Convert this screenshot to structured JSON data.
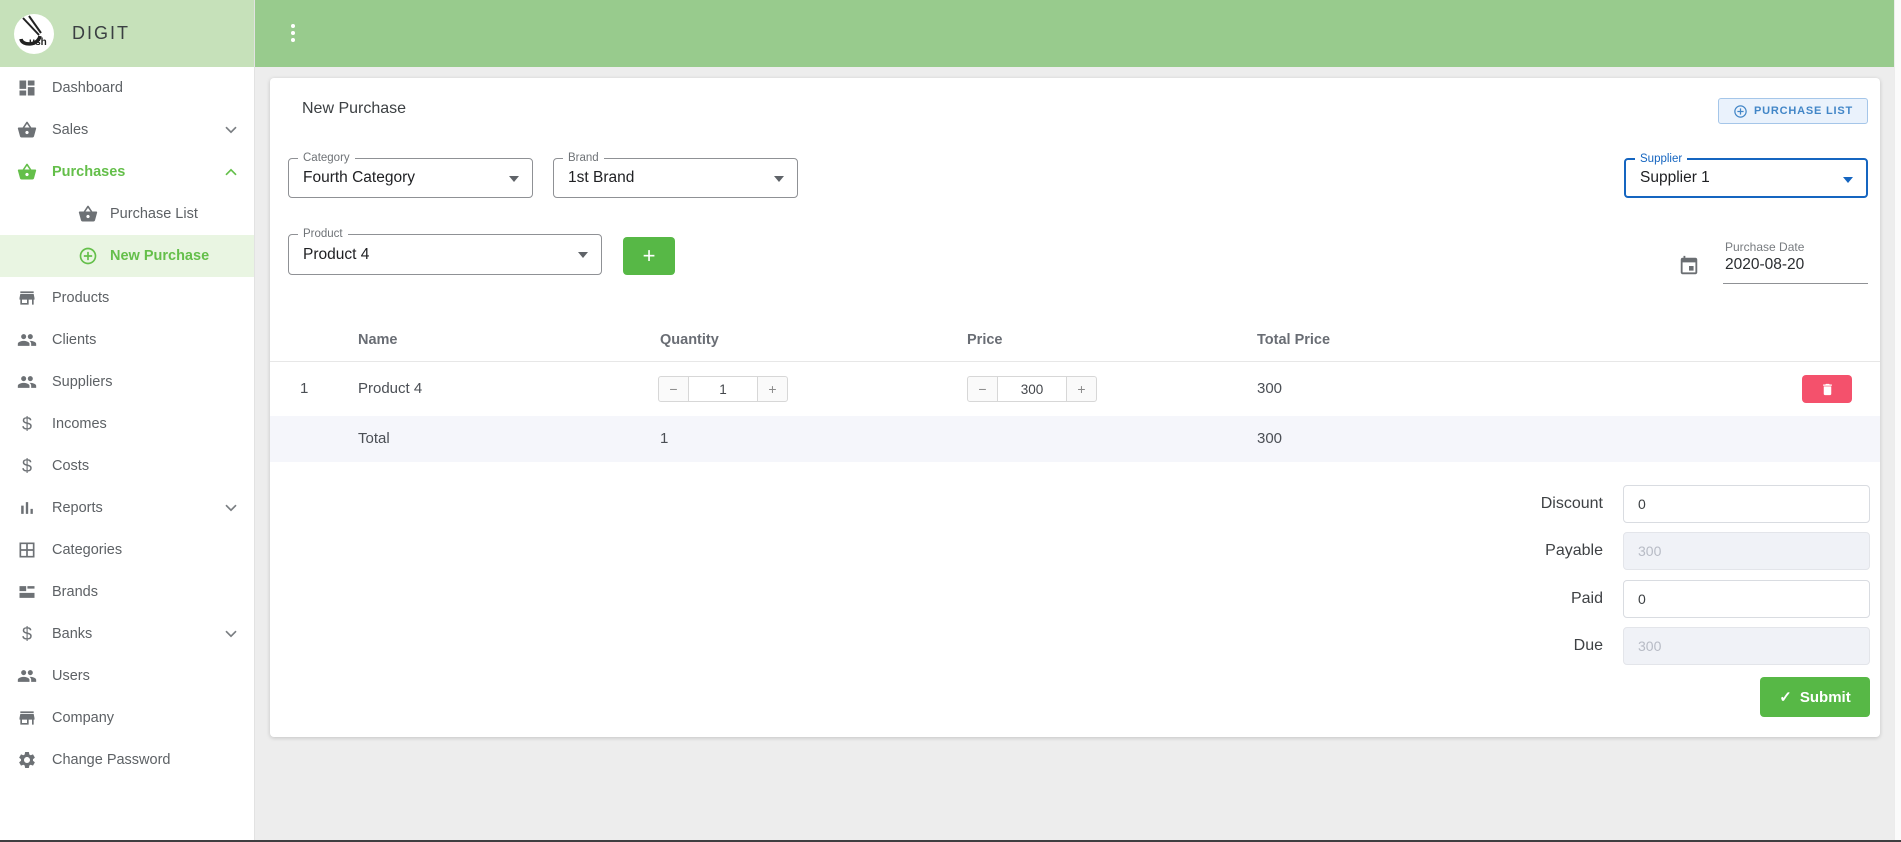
{
  "app": {
    "brand": "DIGIT"
  },
  "sidebar": {
    "items": [
      {
        "label": "Dashboard"
      },
      {
        "label": "Sales"
      },
      {
        "label": "Purchases"
      },
      {
        "label": "Purchase List"
      },
      {
        "label": "New Purchase"
      },
      {
        "label": "Products"
      },
      {
        "label": "Clients"
      },
      {
        "label": "Suppliers"
      },
      {
        "label": "Incomes"
      },
      {
        "label": "Costs"
      },
      {
        "label": "Reports"
      },
      {
        "label": "Categories"
      },
      {
        "label": "Brands"
      },
      {
        "label": "Banks"
      },
      {
        "label": "Users"
      },
      {
        "label": "Company"
      },
      {
        "label": "Change Password"
      }
    ]
  },
  "page": {
    "title": "New Purchase",
    "purchase_list_button": "PURCHASE LIST"
  },
  "form": {
    "category": {
      "label": "Category",
      "value": "Fourth Category"
    },
    "brand": {
      "label": "Brand",
      "value": "1st Brand"
    },
    "supplier": {
      "label": "Supplier",
      "value": "Supplier 1"
    },
    "product": {
      "label": "Product",
      "value": "Product 4"
    },
    "purchase_date": {
      "label": "Purchase Date",
      "value": "2020-08-20"
    }
  },
  "controls": {
    "decrease": "−",
    "increase": "+",
    "add": "+",
    "submit": "Submit"
  },
  "icons": {
    "dollar_glyph": "$",
    "check_glyph": "✓"
  },
  "table": {
    "headers": {
      "name": "Name",
      "quantity": "Quantity",
      "price": "Price",
      "total_price": "Total Price"
    },
    "rows": [
      {
        "index": "1",
        "name": "Product 4",
        "quantity": "1",
        "price": "300",
        "total_price": "300"
      }
    ],
    "total_row": {
      "label": "Total",
      "quantity": "1",
      "total_price": "300"
    }
  },
  "summary": {
    "discount": {
      "label": "Discount",
      "value": "0"
    },
    "payable": {
      "label": "Payable",
      "value": "300"
    },
    "paid": {
      "label": "Paid",
      "value": "0"
    },
    "due": {
      "label": "Due",
      "value": "300"
    }
  },
  "colors": {
    "topbar_green": "#98cb8d",
    "sidebar_header_green": "#c6e1ba",
    "active_green": "#64bf4a",
    "accent_blue": "#1565c0",
    "danger_red": "#f4516c",
    "action_green": "#57b846"
  }
}
